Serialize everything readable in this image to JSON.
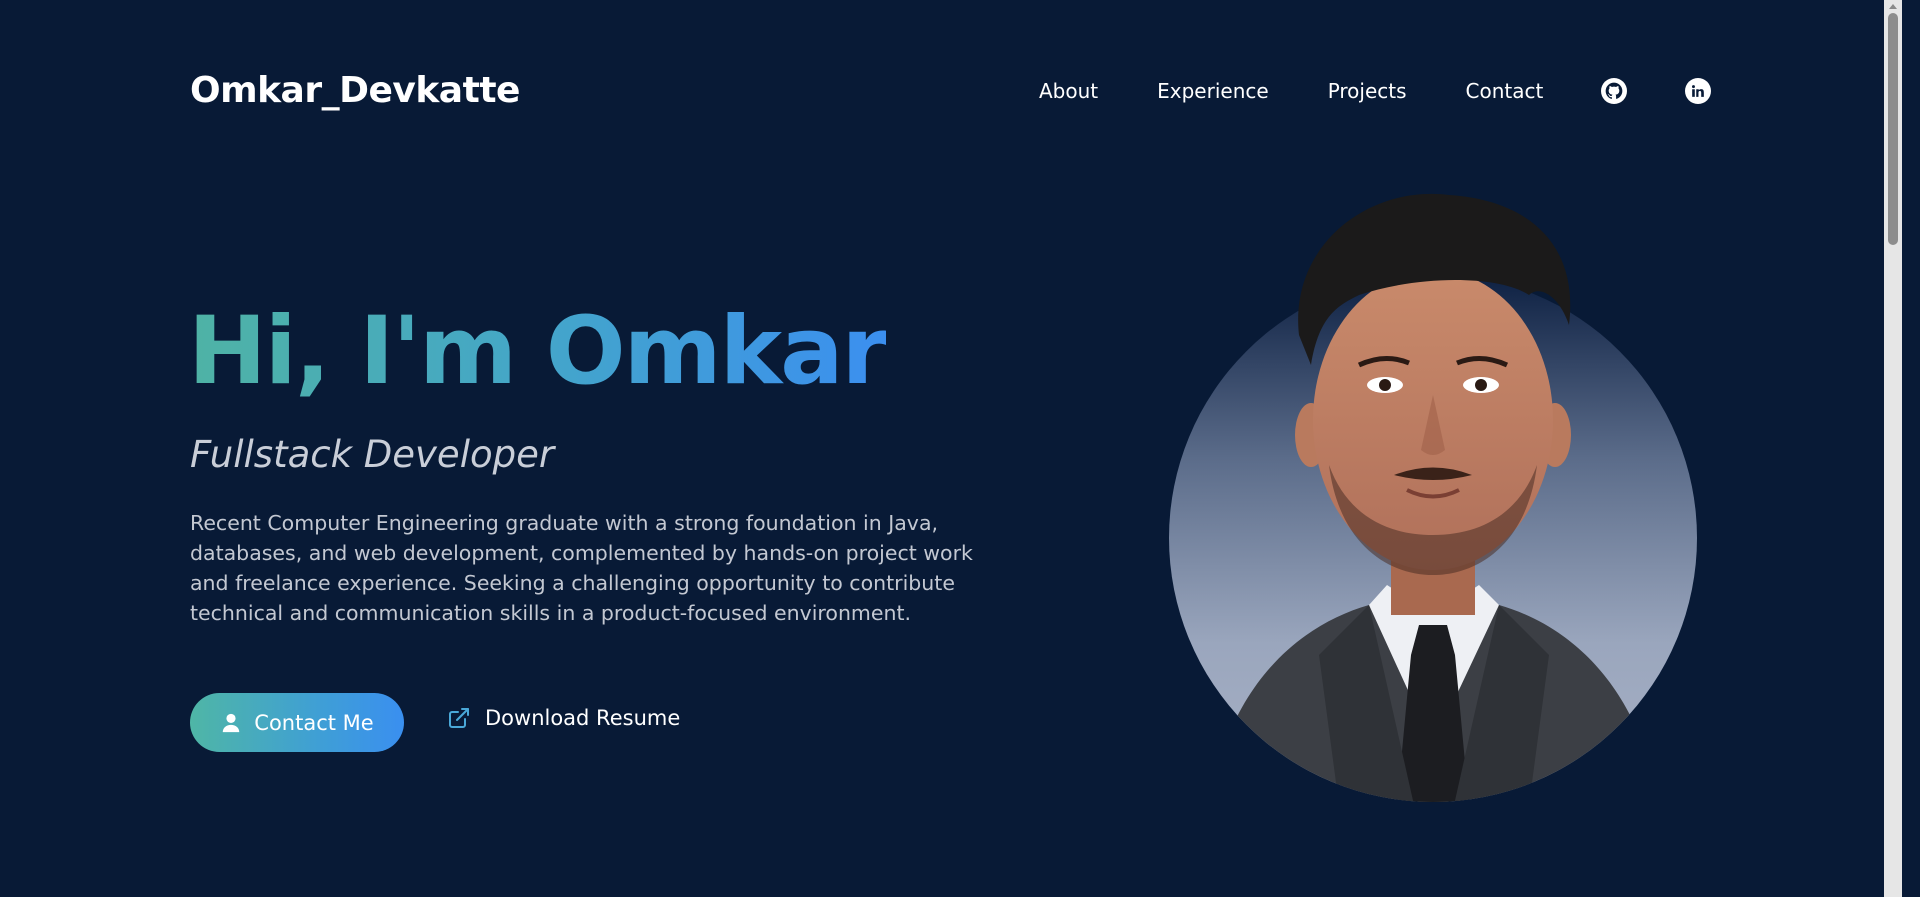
{
  "header": {
    "logo": "Omkar_Devkatte",
    "nav": [
      "About",
      "Experience",
      "Projects",
      "Contact"
    ],
    "social_icons": [
      "github-icon",
      "linkedin-icon"
    ]
  },
  "hero": {
    "title": "Hi, I'm Omkar",
    "subtitle": "Fullstack Developer",
    "description": "Recent Computer Engineering graduate with a strong foundation in Java, databases, and web development, complemented by hands-on project work and freelance experience. Seeking a challenging opportunity to contribute technical and communication skills in a product-focused environment.",
    "contact_button": "Contact Me",
    "resume_button": "Download Resume"
  },
  "colors": {
    "background": "#081a36",
    "gradient_start": "#4fb3a5",
    "gradient_end": "#3b8ff0"
  }
}
